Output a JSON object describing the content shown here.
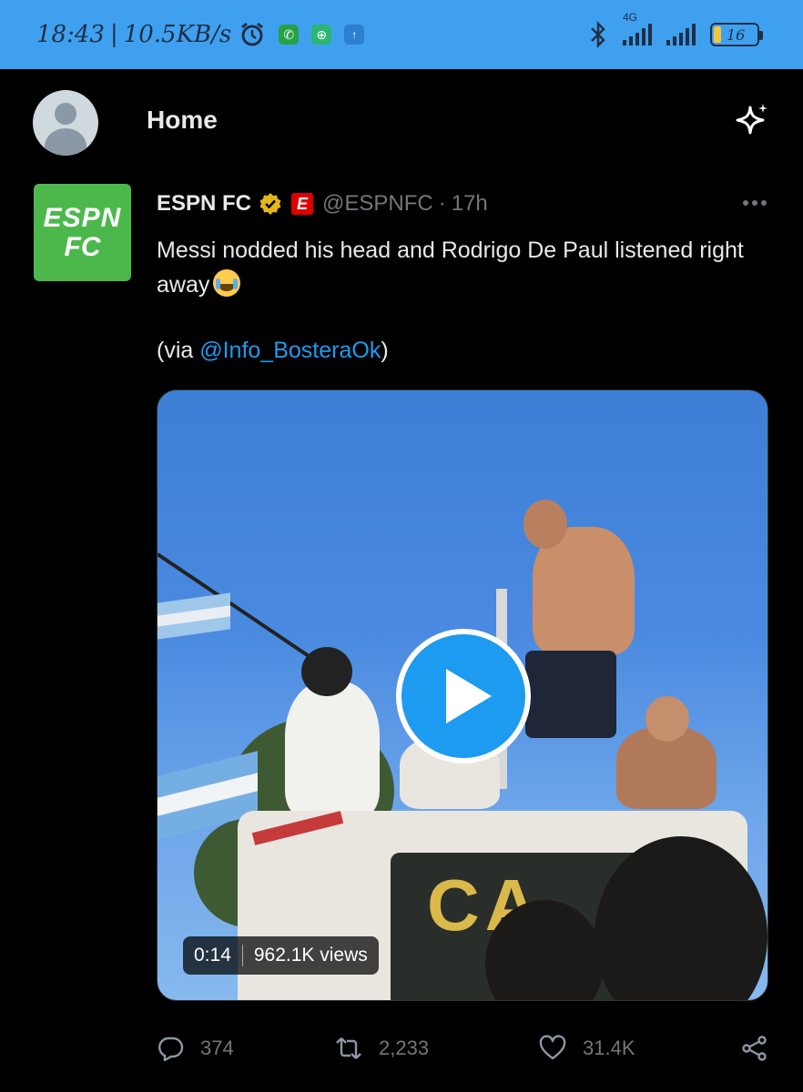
{
  "status_bar": {
    "time": "18:43",
    "separator": "|",
    "net_speed": "10.5KB/s",
    "network_type": "4G",
    "battery": "16",
    "icons": [
      "alarm-icon",
      "whatsapp-icon",
      "app-plus-icon",
      "upload-icon",
      "bluetooth-icon",
      "signal-icon",
      "signal-icon",
      "battery-icon"
    ]
  },
  "header": {
    "title": "Home"
  },
  "tweet": {
    "display_name": "ESPN FC",
    "affiliate_badge": "E",
    "handle": "@ESPNFC",
    "dot": "·",
    "time": "17h",
    "avatar_text_top": "ESPN",
    "avatar_text_bottom": "FC",
    "text": "Messi nodded his head and Rodrigo De Paul listened right away",
    "via_prefix": "(via ",
    "via_mention": "@Info_BosteraOk",
    "via_suffix": ")",
    "media": {
      "duration": "0:14",
      "views": "962.1K views",
      "truck_text": "CA"
    },
    "stats": {
      "replies": "374",
      "retweets": "2,233",
      "likes": "31.4K"
    }
  },
  "colors": {
    "status_bar": "#3fa0f0",
    "background": "#000000",
    "accent": "#1d9bf0",
    "espn_green": "#4cb84c",
    "muted": "#71767b"
  }
}
